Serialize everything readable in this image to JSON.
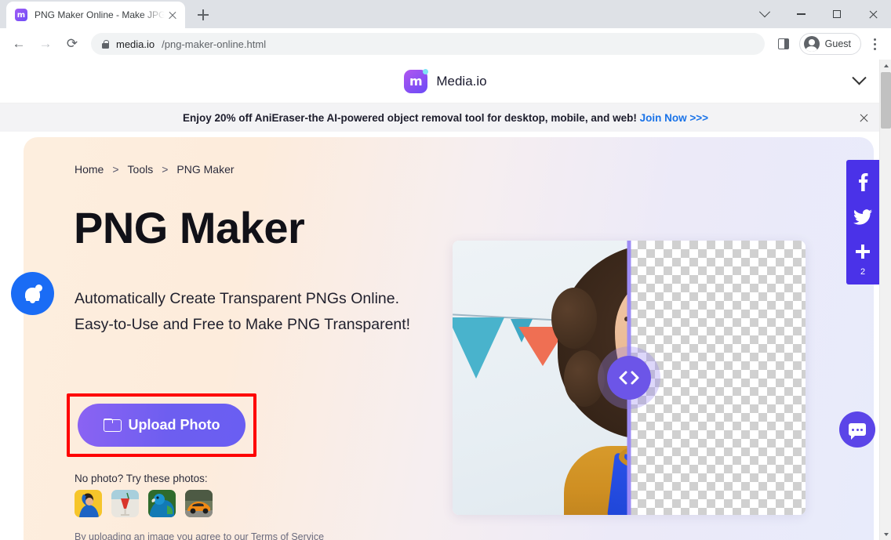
{
  "browser": {
    "tab": {
      "title": "PNG Maker Online - Make JPG",
      "favicon": "media-io-favicon",
      "close_label": "×"
    },
    "new_tab_label": "+",
    "window_controls": {
      "minimize": "—",
      "maximize": "□",
      "close": "×",
      "chevron": "v"
    },
    "toolbar": {
      "back": "←",
      "forward": "→",
      "reload": "⟳",
      "url_host": "media.io",
      "url_path": "/png-maker-online.html",
      "lock_icon": "lock-icon",
      "side_panel_icon": "side-panel-icon",
      "profile_label": "Guest",
      "menu_icon": "kebab-menu-icon"
    }
  },
  "site_header": {
    "brand_name": "Media.io",
    "brand_mark": "m",
    "chevron_icon": "chevron-down-icon"
  },
  "promo": {
    "text": "Enjoy 20% off AniEraser-the AI-powered object removal tool for desktop, mobile, and web!",
    "link_text": "Join Now",
    "link_arrows": ">>>",
    "close_icon": "close-icon"
  },
  "hero": {
    "breadcrumb": [
      {
        "label": "Home"
      },
      {
        "label": "Tools"
      },
      {
        "label": "PNG Maker"
      }
    ],
    "breadcrumb_separator": ">",
    "title": "PNG Maker",
    "subtitle": "Automatically Create Transparent PNGs Online. Easy-to-Use and Free to Make PNG Transparent!",
    "upload_button": {
      "label": "Upload Photo",
      "icon": "folder-icon",
      "highlight_color": "#fe0000"
    },
    "sample_label": "No photo? Try these photos:",
    "samples": [
      {
        "name": "person-yellow-thumbnail"
      },
      {
        "name": "red-drink-thumbnail"
      },
      {
        "name": "blue-parrot-thumbnail"
      },
      {
        "name": "orange-sportscar-thumbnail"
      }
    ],
    "terms_prefix": "By uploading an image you agree to our ",
    "terms_link": "Terms of Service",
    "preview": {
      "alt": "before-after-portrait-transparency",
      "handle_icon": "left-right-chevrons"
    }
  },
  "widgets": {
    "notification": {
      "icon": "bell-icon",
      "color": "#1a6cf5"
    },
    "share_rail": {
      "color": "#4a32e8",
      "items": [
        {
          "icon": "facebook-icon",
          "glyph": "f"
        },
        {
          "icon": "twitter-icon",
          "glyph": "t"
        },
        {
          "icon": "plus-icon",
          "glyph": "+"
        }
      ],
      "count": "2"
    },
    "chat": {
      "icon": "chat-bubble-icon",
      "color": "#5b45e8"
    }
  }
}
